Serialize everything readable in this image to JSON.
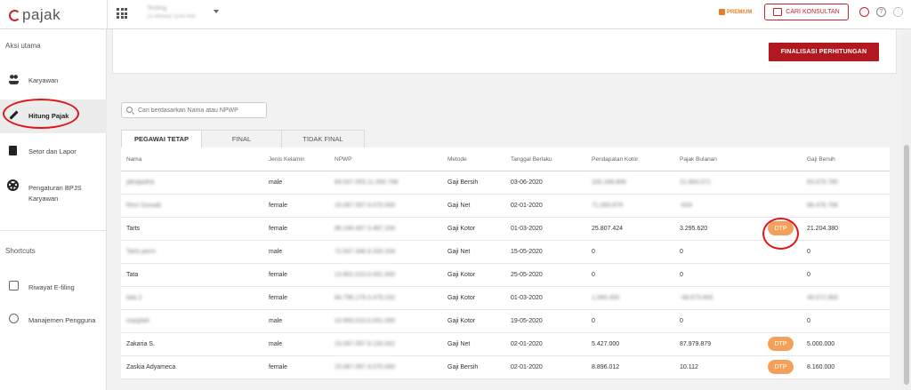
{
  "header": {
    "logo_text": "pajak",
    "company_name": "Testing",
    "company_npwp": "21.445502.1100.000",
    "premium_label": "PREMIUM",
    "consult_button": "CARI KONSULTAN",
    "help_icon_glyph": "?"
  },
  "sidebar": {
    "section_main": "Aksi utama",
    "items": [
      {
        "label": "Karyawan",
        "icon": "people-icon"
      },
      {
        "label": "Hitung Pajak",
        "icon": "pencil-icon"
      },
      {
        "label": "Setor dan Lapor",
        "icon": "document-icon"
      },
      {
        "label": "Pengaturan BPJS Karyawan",
        "icon": "gear-icon"
      }
    ],
    "section_shortcuts": "Shortcuts",
    "shortcuts": [
      {
        "label": "Riwayat E-filing",
        "icon": "history-icon"
      },
      {
        "label": "Manajemen Pengguna",
        "icon": "users-icon"
      }
    ]
  },
  "main": {
    "finalize_button": "FINALISASI PERHITUNGAN",
    "search_placeholder": "Cari berdasarkan Nama atau NPWP",
    "tabs": [
      {
        "label": "PEGAWAI TETAP",
        "active": true
      },
      {
        "label": "FINAL",
        "active": false
      },
      {
        "label": "TIDAK FINAL",
        "active": false
      }
    ],
    "table": {
      "headers": {
        "nama": "Nama",
        "jenis_kelamin": "Jenis Kelamin",
        "npwp": "NPWP",
        "metode": "Metode",
        "tanggal_berlaku": "Tanggal Berlaku",
        "pendapatan_kotor": "Pendapatan Kotor",
        "pajak_bulanan": "Pajak Bulanan",
        "gaji_bersih": "Gaji Bersih"
      },
      "rows": [
        {
          "nama": "jdksljadhd",
          "jk": "male",
          "npwp": "83.537.053.11.050.768",
          "metode": "Gaji Bersih",
          "tgl": "03-06-2020",
          "pk": "100.348.806",
          "pb": "21.664.071",
          "dtp": "",
          "gb": "83.679.780",
          "blur_nama": true,
          "blur_values": true
        },
        {
          "nama": "Rinn Gunadi",
          "jk": "female",
          "npwp": "15.067.097.9.070.000",
          "metode": "Gaji Net",
          "tgl": "02-01-2020",
          "pk": "71.083.879",
          "pb": "-834",
          "dtp": "",
          "gb": "68.476.766",
          "blur_nama": true,
          "blur_values": true
        },
        {
          "nama": "Tarts",
          "jk": "female",
          "npwp": "86.246.487.3.487.334",
          "metode": "Gaji Kotor",
          "tgl": "01-03-2020",
          "pk": "25.807.424",
          "pb": "3.295.620",
          "dtp": "DTP",
          "gb": "21.204.380",
          "blur_nama": false,
          "blur_values": false
        },
        {
          "nama": "Tarts perm",
          "jk": "male",
          "npwp": "72.647.346.9.334.334",
          "metode": "Gaji Net",
          "tgl": "15-05-2020",
          "pk": "0",
          "pb": "0",
          "dtp": "",
          "gb": "0",
          "blur_nama": true,
          "blur_values": false
        },
        {
          "nama": "Tata",
          "jk": "female",
          "npwp": "13.901.010.0.001.000",
          "metode": "Gaji Kotor",
          "tgl": "25-05-2020",
          "pk": "0",
          "pb": "0",
          "dtp": "",
          "gb": "0",
          "blur_nama": false,
          "blur_values": false
        },
        {
          "nama": "tata 2",
          "jk": "female",
          "npwp": "84.796.279.3.479.232",
          "metode": "Gaji Kotor",
          "tgl": "01-03-2020",
          "pk": "1.060.400",
          "pb": "-48.673.900",
          "dtp": "",
          "gb": "49.072.900",
          "blur_nama": true,
          "blur_values": true
        },
        {
          "nama": "masjifah",
          "jk": "male",
          "npwp": "10.900.010.0.001.000",
          "metode": "Gaji Kotor",
          "tgl": "19-05-2020",
          "pk": "0",
          "pb": "0",
          "dtp": "",
          "gb": "0",
          "blur_nama": true,
          "blur_values": false
        },
        {
          "nama": "Zakaria S.",
          "jk": "male",
          "npwp": "15.067.097.9.130.001",
          "metode": "Gaji Net",
          "tgl": "02-01-2020",
          "pk": "5.427.000",
          "pb": "87.979.879",
          "dtp": "DTP",
          "gb": "5.000.000",
          "blur_nama": false,
          "blur_values": false
        },
        {
          "nama": "Zaskia Adyameca",
          "jk": "female",
          "npwp": "15.067.097.9.070.000",
          "metode": "Gaji Bersih",
          "tgl": "02-01-2020",
          "pk": "8.896.012",
          "pb": "10.112",
          "dtp": "DTP",
          "gb": "8.160.000",
          "blur_nama": false,
          "blur_values": false
        }
      ]
    }
  },
  "colors": {
    "brand_red": "#c9232d",
    "finalize_bg": "#b3171f",
    "dtp_badge": "#f3a15a",
    "annotation_red": "#e0141b"
  }
}
